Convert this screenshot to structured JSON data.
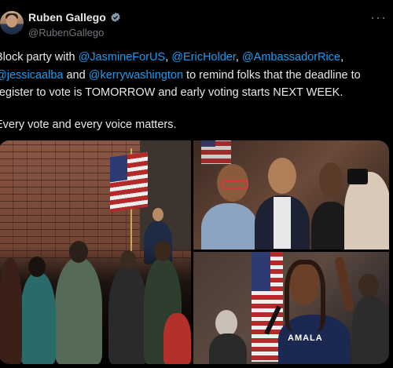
{
  "author": {
    "display_name": "Ruben Gallego",
    "handle": "@RubenGallego",
    "verified": true
  },
  "menu": {
    "more_label": "···"
  },
  "tweet": {
    "line1_prefix": "Block party with ",
    "mention_jasmine": "@JasmineForUS",
    "sep1": ", ",
    "mention_holder": "@EricHolder",
    "sep2": ", ",
    "mention_rice": "@AmbassadorRice",
    "sep3": ",",
    "mention_alba": "@jessicaalba",
    "and_text": " and ",
    "mention_washington": "@kerrywashington",
    "line2_suffix": " to remind folks that the deadline to",
    "line3": "register to vote is TOMORROW and early voting starts NEXT WEEK.",
    "line4": "Every vote and every voice matters."
  },
  "media": {
    "photo_count": 3,
    "photo3_shirt_text": "AMALA"
  },
  "colors": {
    "background": "#000000",
    "text": "#e7e9ea",
    "mention": "#1d9bf0",
    "muted": "#71767b",
    "verified": "#829aab"
  },
  "icons": {
    "verified": "verified-badge-icon",
    "more": "more-options-icon"
  }
}
